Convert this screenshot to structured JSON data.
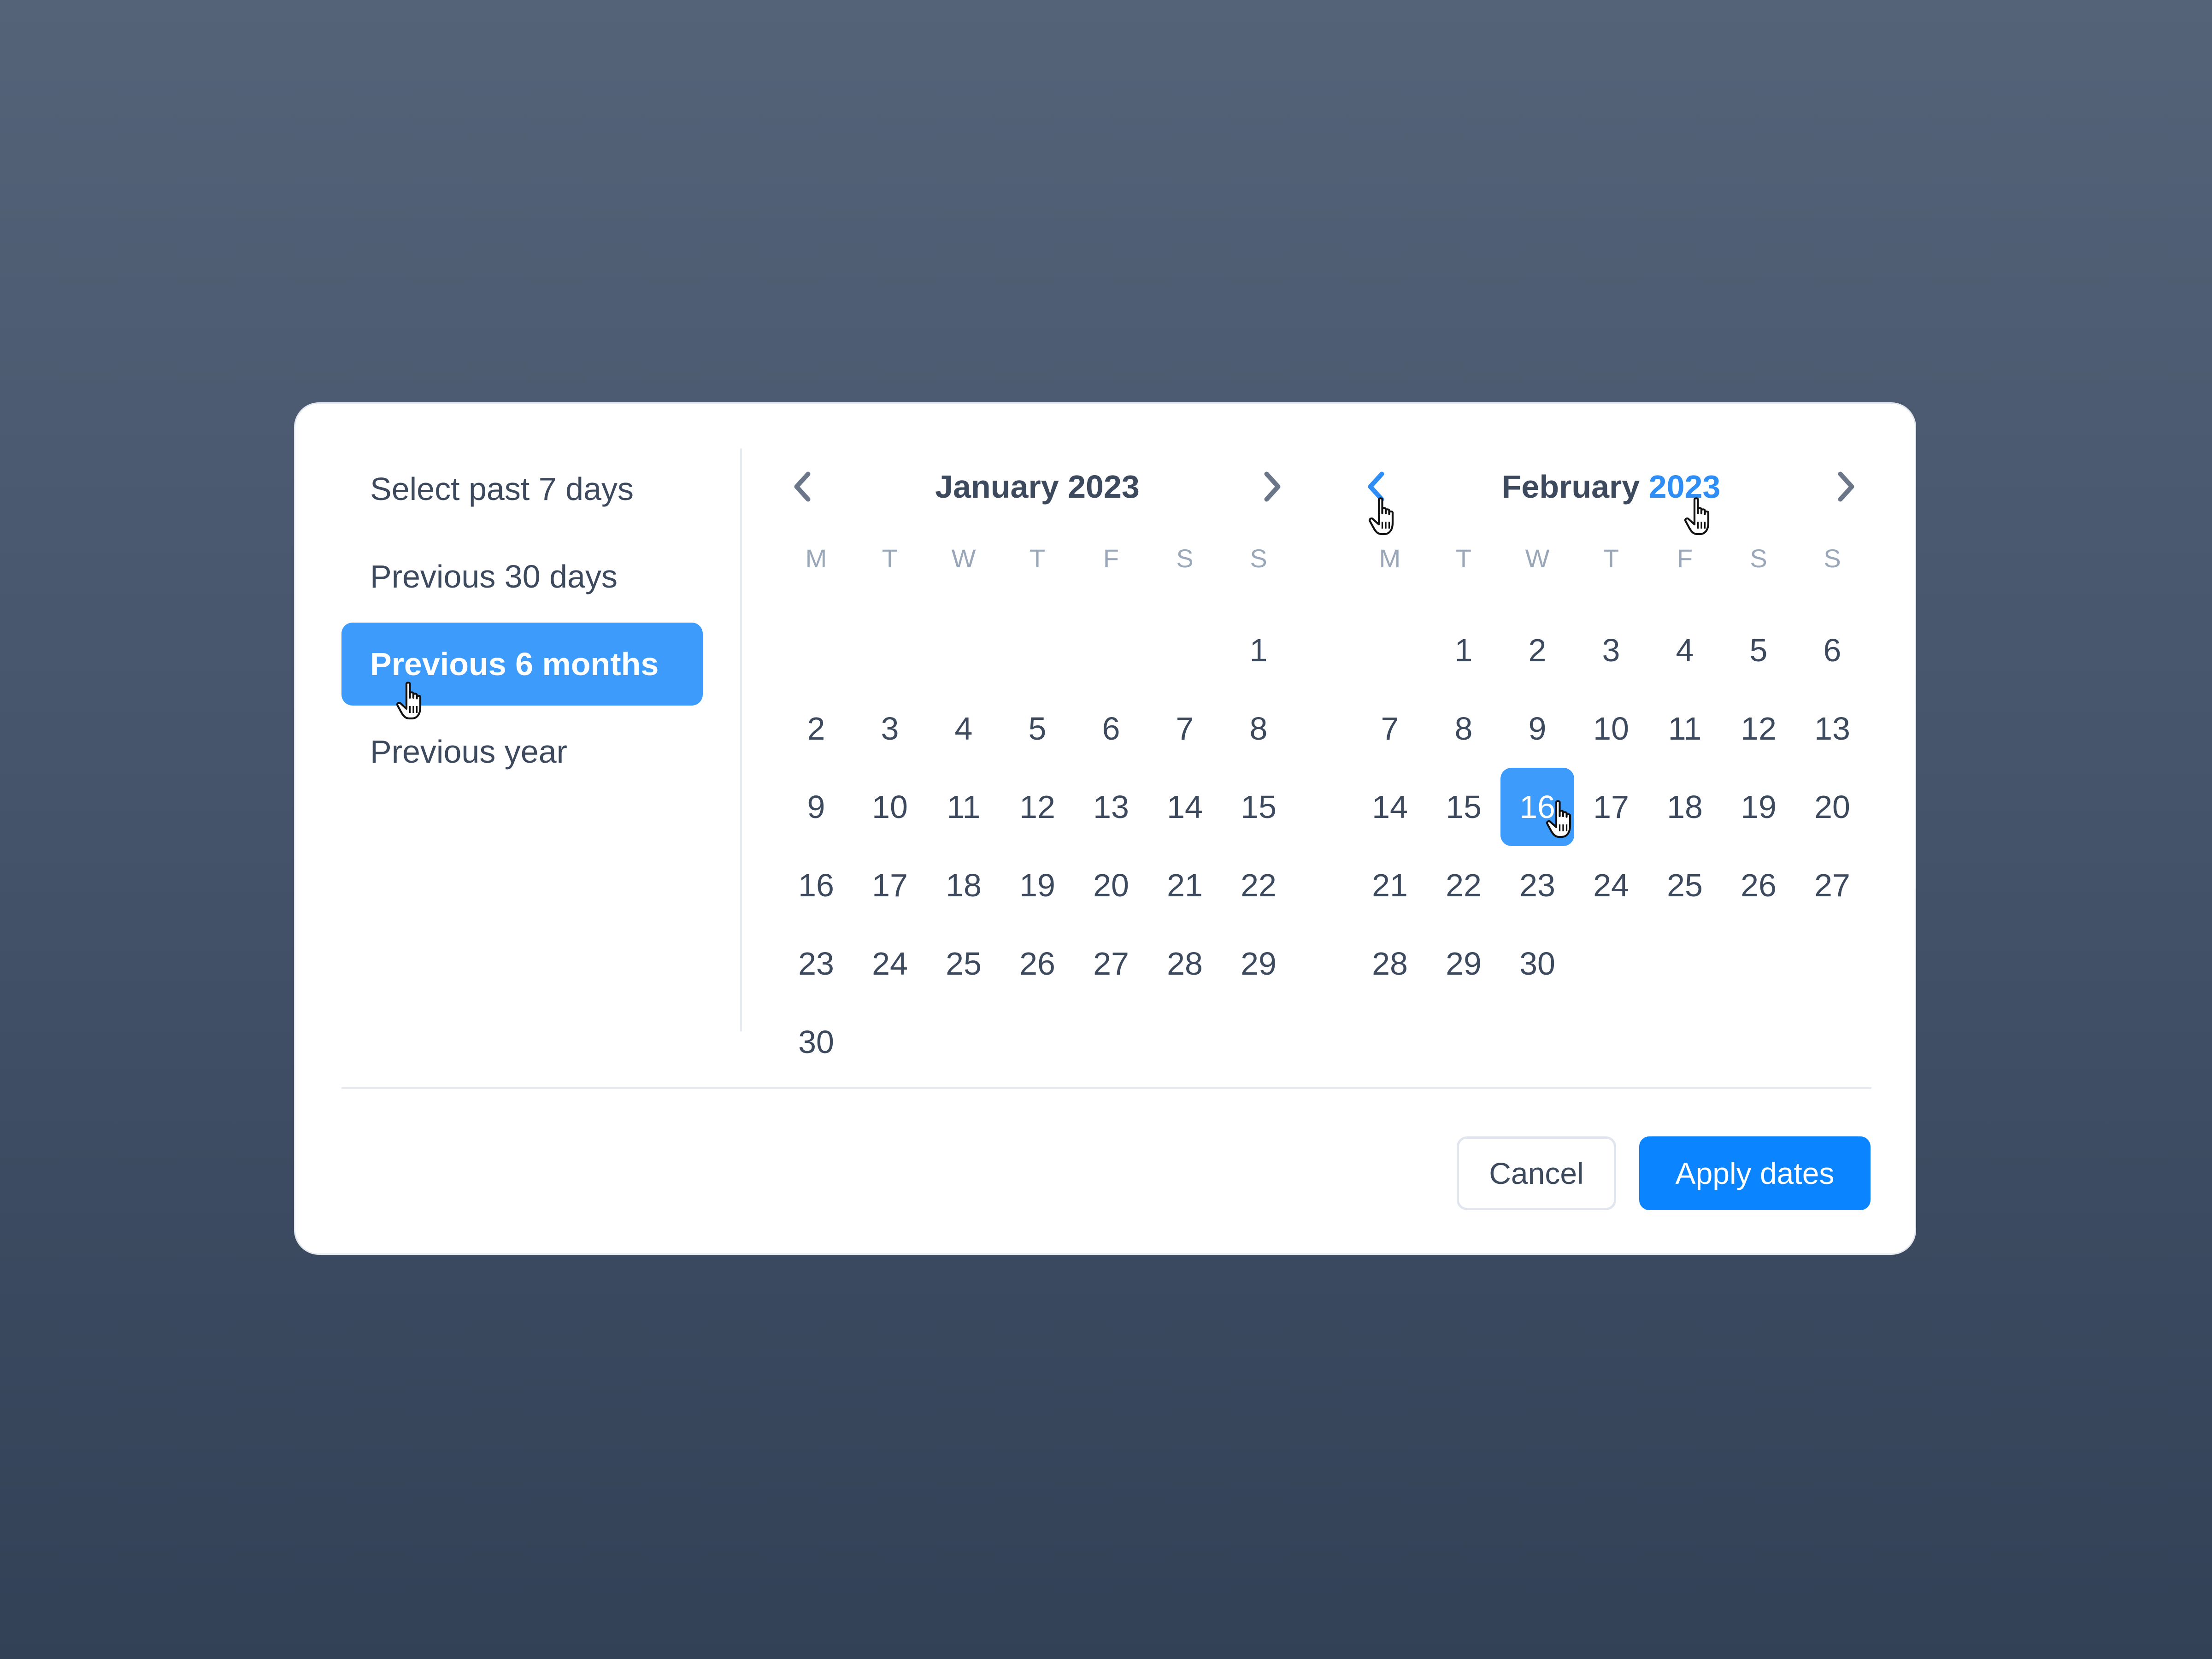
{
  "presets": [
    {
      "label": "Select past 7 days",
      "active": false
    },
    {
      "label": "Previous 30 days",
      "active": false
    },
    {
      "label": "Previous 6 months",
      "active": true
    },
    {
      "label": "Previous year",
      "active": false
    }
  ],
  "weekdays": [
    "M",
    "T",
    "W",
    "T",
    "F",
    "S",
    "S"
  ],
  "calendars": [
    {
      "month": "January",
      "year": "2023",
      "year_highlighted": false,
      "prev_highlighted": false,
      "first_weekday_index": 6,
      "days": 30,
      "selected_day": null
    },
    {
      "month": "February",
      "year": "2023",
      "year_highlighted": true,
      "prev_highlighted": true,
      "first_weekday_index": 1,
      "days": 30,
      "selected_day": 16
    }
  ],
  "footer": {
    "cancel_label": "Cancel",
    "apply_label": "Apply dates"
  },
  "colors": {
    "accent": "#3d9bfb",
    "primary_button": "#0a84ff",
    "text": "#3d4a5e",
    "muted": "#9aa7b8",
    "highlight_text": "#2e8ef5"
  },
  "icons": {
    "prev": "chevron-left-icon",
    "next": "chevron-right-icon",
    "cursor": "hand-pointer-icon"
  }
}
